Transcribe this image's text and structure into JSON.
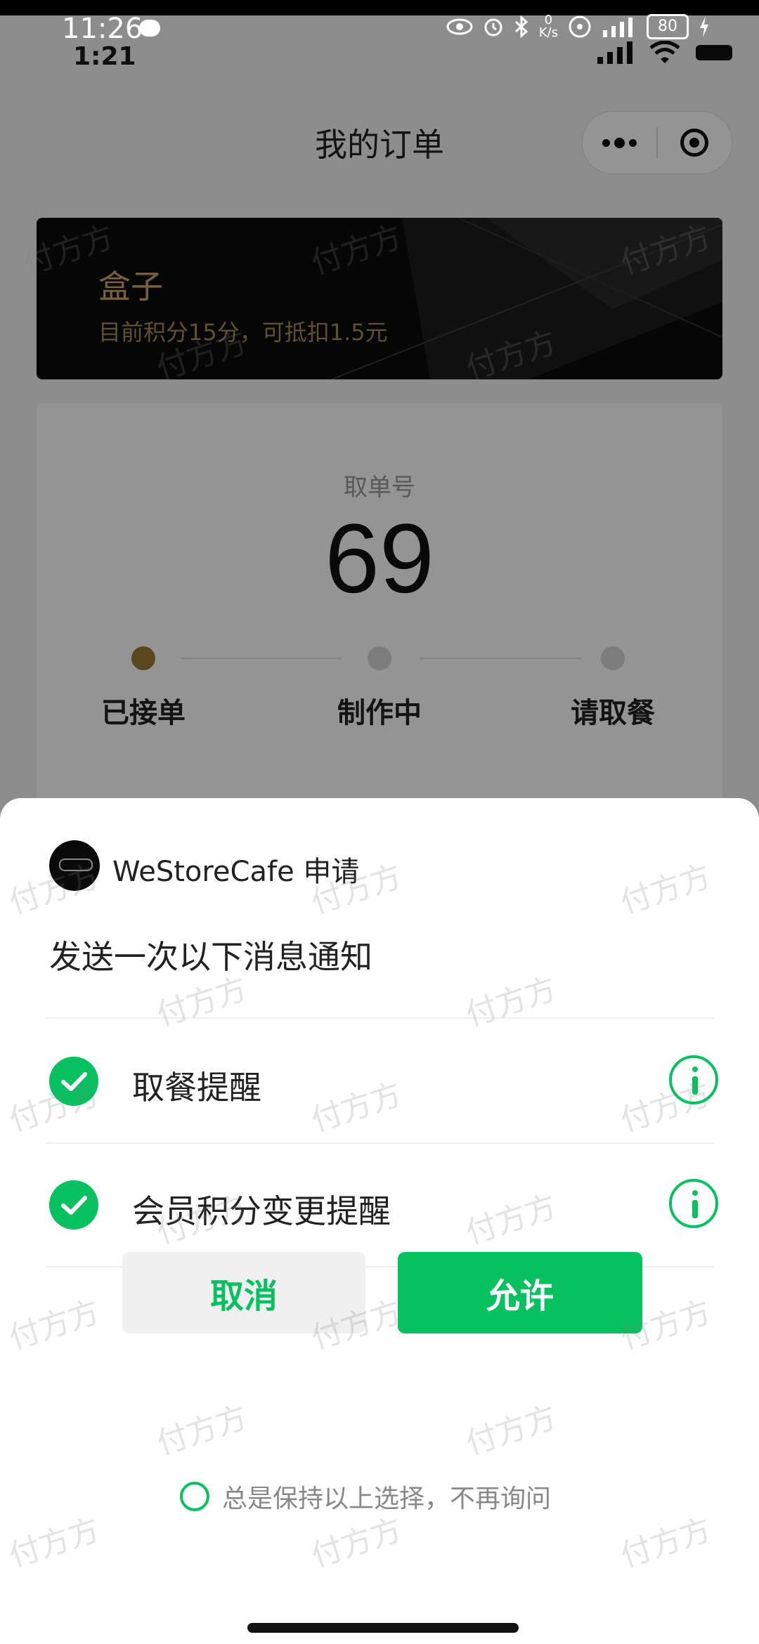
{
  "status_bar_top": {
    "time": "11:26",
    "net_speed_value": "0",
    "net_speed_unit": "K/s",
    "battery": "80"
  },
  "status_bar_app": {
    "time": "1:21"
  },
  "nav": {
    "title": "我的订单"
  },
  "member_card": {
    "name": "盒子",
    "points_text": "目前积分15分，可抵扣1.5元"
  },
  "order": {
    "number_label": "取单号",
    "number": "69",
    "steps": [
      {
        "label": "已接单",
        "active": true
      },
      {
        "label": "制作中",
        "active": false
      },
      {
        "label": "请取餐",
        "active": false
      }
    ]
  },
  "sheet": {
    "app_name": "WeStoreCafe 申请",
    "title": "发送一次以下消息通知",
    "items": [
      {
        "label": "取餐提醒",
        "checked": true,
        "icon": "info-icon"
      },
      {
        "label": "会员积分变更提醒",
        "checked": true,
        "icon": "info-icon"
      }
    ],
    "cancel_label": "取消",
    "allow_label": "允许",
    "always_label": "总是保持以上选择，不再询问"
  },
  "watermark": "付方方",
  "colors": {
    "accent": "#07c160",
    "gold": "#caa968",
    "active_step": "#9c7a34"
  }
}
